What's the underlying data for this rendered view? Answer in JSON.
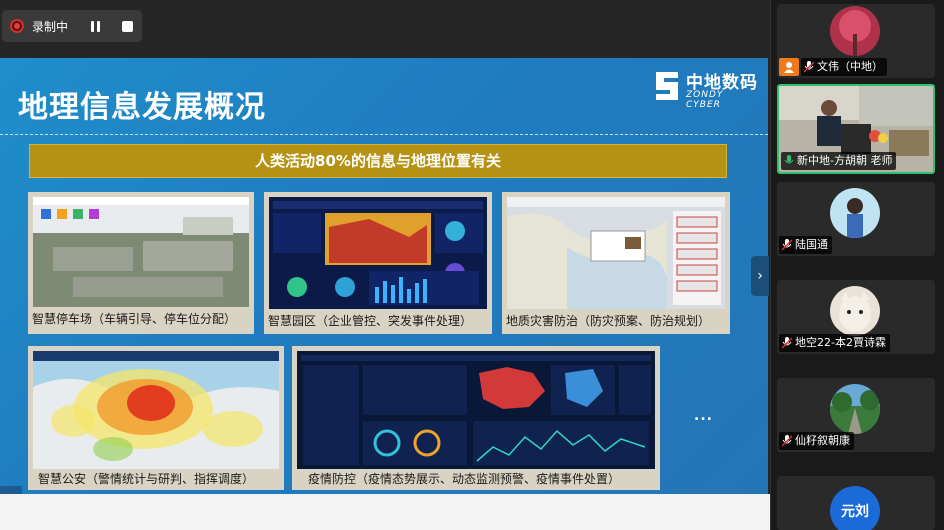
{
  "recording": {
    "status_label": "录制中",
    "pause_icon": "pause-icon",
    "stop_icon": "stop-icon"
  },
  "slide": {
    "title": "地理信息发展概况",
    "banner": "人类活动80%的信息与地理位置有关",
    "logo_cn": "中地数码",
    "logo_en": "ZONDY CYBER",
    "more": "...",
    "cards": [
      {
        "caption": "智慧停车场（车辆引导、停车位分配）"
      },
      {
        "caption": "智慧园区（企业管控、突发事件处理）"
      },
      {
        "caption": "地质灾害防治（防灾预案、防治规划）"
      },
      {
        "caption": "智慧公安（警情统计与研判、指挥调度）"
      },
      {
        "caption": "疫情防控（疫情态势展示、动态监测预警、疫情事件处置）"
      }
    ]
  },
  "participants": [
    {
      "name": "文伟（中地）",
      "mic": "mic-muted-icon",
      "host": true,
      "avatar": "red-tree"
    },
    {
      "name": "新中地-方胡朝 老师",
      "mic": "mic-active-icon",
      "host": false,
      "avatar": "video",
      "active": true
    },
    {
      "name": "陆国通",
      "mic": "mic-muted-icon",
      "host": false,
      "avatar": "person-blue"
    },
    {
      "name": "地空22-本2賈诗霖",
      "mic": "mic-muted-icon",
      "host": false,
      "avatar": "cat"
    },
    {
      "name": "仙籽叙朝康",
      "mic": "mic-muted-icon",
      "host": false,
      "avatar": "road"
    },
    {
      "name": "元刘",
      "mic": "",
      "host": false,
      "avatar": "blue-circle"
    }
  ],
  "colors": {
    "slide_bg": "#1f8ecb",
    "banner": "#b59114",
    "active_border": "#2fbf6f",
    "host_badge": "#f07a1a"
  }
}
